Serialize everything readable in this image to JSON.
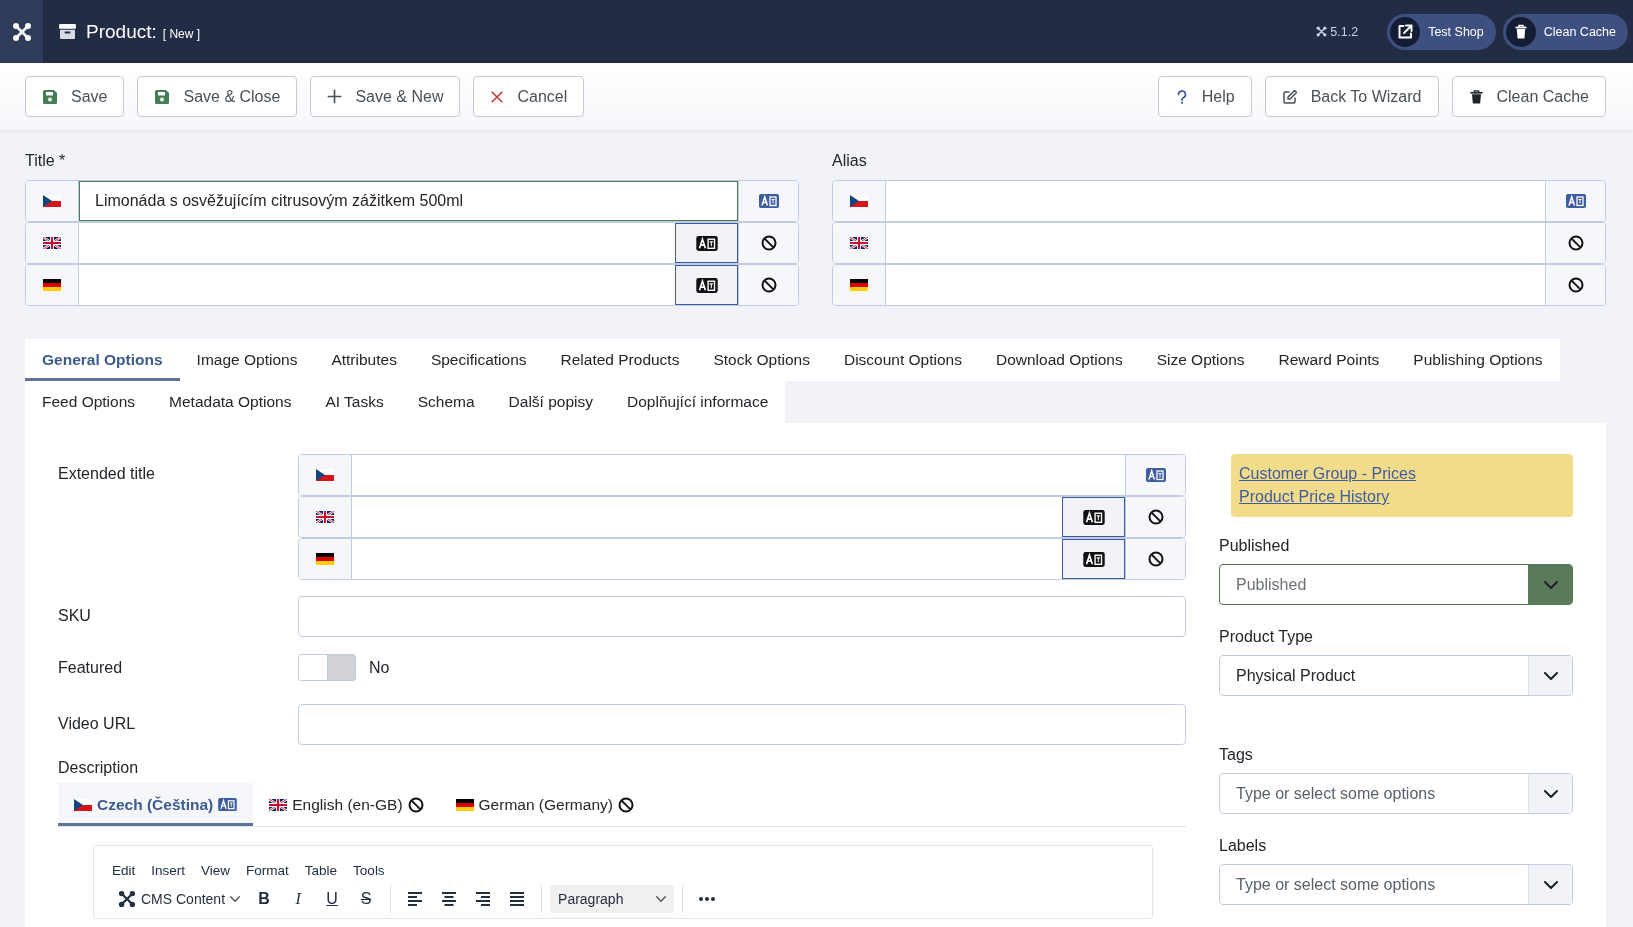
{
  "header": {
    "title": "Product:",
    "status": "[ New ]",
    "version": "5.1.2",
    "buttons": [
      {
        "label": "Test Shop",
        "kind": "link"
      },
      {
        "label": "Clean Cache",
        "kind": "trash"
      }
    ]
  },
  "toolbar": {
    "left": [
      {
        "label": "Save",
        "kind": "save"
      },
      {
        "label": "Save & Close",
        "kind": "save"
      },
      {
        "label": "Save & New",
        "kind": "new"
      },
      {
        "label": "Cancel",
        "kind": "cancel"
      }
    ],
    "right": [
      {
        "label": "Help",
        "kind": "help"
      },
      {
        "label": "Back To Wizard",
        "kind": "edit"
      },
      {
        "label": "Clean Cache",
        "kind": "trash"
      }
    ]
  },
  "title": {
    "label": "Title *",
    "rows": [
      {
        "kind": "cs",
        "source": true,
        "translate_button": false,
        "valid": true,
        "value": "Limonáda s osvěžujícím citrusovým zážitkem 500ml"
      },
      {
        "kind": "en",
        "source": false,
        "translate_button": true,
        "valid": false
      },
      {
        "kind": "de",
        "source": false,
        "translate_button": true,
        "valid": false
      }
    ]
  },
  "alias": {
    "label": "Alias",
    "rows": [
      {
        "kind": "cs",
        "source": true,
        "translate_button": false,
        "valid": false
      },
      {
        "kind": "en",
        "source": false,
        "translate_button": false,
        "valid": false
      },
      {
        "kind": "de",
        "source": false,
        "translate_button": false,
        "valid": false
      }
    ]
  },
  "tab_rows": [
    [
      {
        "label": "General Options",
        "selected": true
      },
      {
        "label": "Image Options",
        "selected": false
      },
      {
        "label": "Attributes",
        "selected": false
      },
      {
        "label": "Specifications",
        "selected": false
      },
      {
        "label": "Related Products",
        "selected": false
      },
      {
        "label": "Stock Options",
        "selected": false
      },
      {
        "label": "Discount Options",
        "selected": false
      },
      {
        "label": "Download Options",
        "selected": false
      },
      {
        "label": "Size Options",
        "selected": false
      },
      {
        "label": "Reward Points",
        "selected": false
      },
      {
        "label": "Publishing Options",
        "selected": false
      }
    ],
    [
      {
        "label": "Feed Options",
        "selected": false
      },
      {
        "label": "Metadata Options",
        "selected": false
      },
      {
        "label": "AI Tasks",
        "selected": false
      },
      {
        "label": "Schema",
        "selected": false
      },
      {
        "label": "Další popisy",
        "selected": false
      },
      {
        "label": "Doplňující informace",
        "selected": false
      }
    ]
  ],
  "form": {
    "extended_title": {
      "label": "Extended title",
      "rows": [
        {
          "kind": "cs",
          "source": true,
          "translate_button": false,
          "valid": false
        },
        {
          "kind": "en",
          "source": false,
          "translate_button": true,
          "valid": false
        },
        {
          "kind": "de",
          "source": false,
          "translate_button": true,
          "valid": false
        }
      ]
    },
    "sku": {
      "label": "SKU"
    },
    "featured": {
      "label": "Featured",
      "on": false,
      "text": "No"
    },
    "video_url": {
      "label": "Video URL"
    },
    "description": {
      "label": "Description",
      "tabs": [
        {
          "label": "Czech (Čeština)",
          "kind": "cs",
          "source": true,
          "selected": true
        },
        {
          "label": "English (en-GB)",
          "kind": "en",
          "source": false,
          "selected": false
        },
        {
          "label": "German (Germany)",
          "kind": "de",
          "source": false,
          "selected": false
        }
      ],
      "editor": {
        "menu": [
          "Edit",
          "Insert",
          "View",
          "Format",
          "Table",
          "Tools"
        ],
        "toolbar_groups": [
          [
            {
              "kind": "blocks",
              "label": "CMS Content"
            },
            {
              "kind": "bold",
              "label": "B"
            },
            {
              "kind": "italic",
              "label": "I"
            },
            {
              "kind": "underline",
              "label": "U"
            },
            {
              "kind": "strike",
              "label": "S"
            }
          ],
          [
            {
              "kind": "align-left"
            },
            {
              "kind": "align-center"
            },
            {
              "kind": "align-right"
            },
            {
              "kind": "justify"
            }
          ],
          [
            {
              "kind": "format",
              "label": "Paragraph"
            }
          ],
          [
            {
              "kind": "more"
            }
          ]
        ]
      }
    }
  },
  "sidebar": {
    "links": [
      "Customer Group - Prices",
      "Product Price History"
    ],
    "selects": [
      {
        "label": "Published",
        "value": "Published",
        "valid": true
      },
      {
        "label": "Product Type",
        "value": "Physical Product",
        "valid": false
      },
      {
        "label": "Tags",
        "placeholder": "Type or select some options",
        "valid": false
      },
      {
        "label": "Labels",
        "placeholder": "Type or select some options",
        "valid": false
      }
    ]
  }
}
